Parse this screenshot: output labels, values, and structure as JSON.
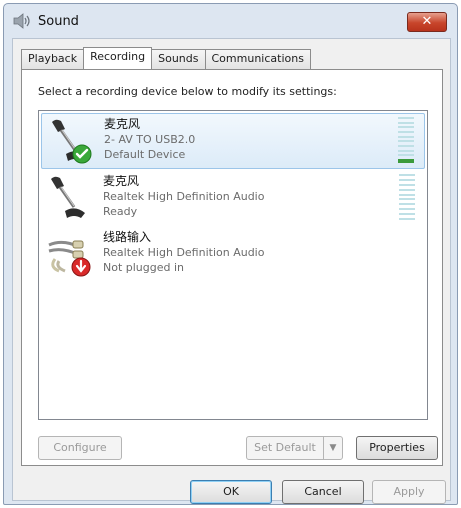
{
  "window": {
    "title": "Sound",
    "close_label": "✕"
  },
  "tabs": [
    {
      "label": "Playback",
      "active": false
    },
    {
      "label": "Recording",
      "active": true
    },
    {
      "label": "Sounds",
      "active": false
    },
    {
      "label": "Communications",
      "active": false
    }
  ],
  "instruction": "Select a recording device below to modify its settings:",
  "devices": [
    {
      "name": "麦克风",
      "driver": "2- AV TO USB2.0",
      "status": "Default Device",
      "selected": true,
      "icon": "microphone-icon",
      "badge": "default-checkmark-icon",
      "level": 0.1
    },
    {
      "name": "麦克风",
      "driver": "Realtek High Definition Audio",
      "status": "Ready",
      "selected": false,
      "icon": "microphone-icon",
      "level": 0
    },
    {
      "name": "线路输入",
      "driver": "Realtek High Definition Audio",
      "status": "Not plugged in",
      "selected": false,
      "icon": "line-in-cable-icon",
      "badge": "unplugged-arrow-icon"
    }
  ],
  "buttons": {
    "configure": "Configure",
    "set_default": "Set Default",
    "properties": "Properties",
    "ok": "OK",
    "cancel": "Cancel",
    "apply": "Apply"
  },
  "colors": {
    "selection": "#dcebf8",
    "close": "#c8452b",
    "meter_lit": "#3b9a3b",
    "meter_idle": "#bfe0e6"
  }
}
